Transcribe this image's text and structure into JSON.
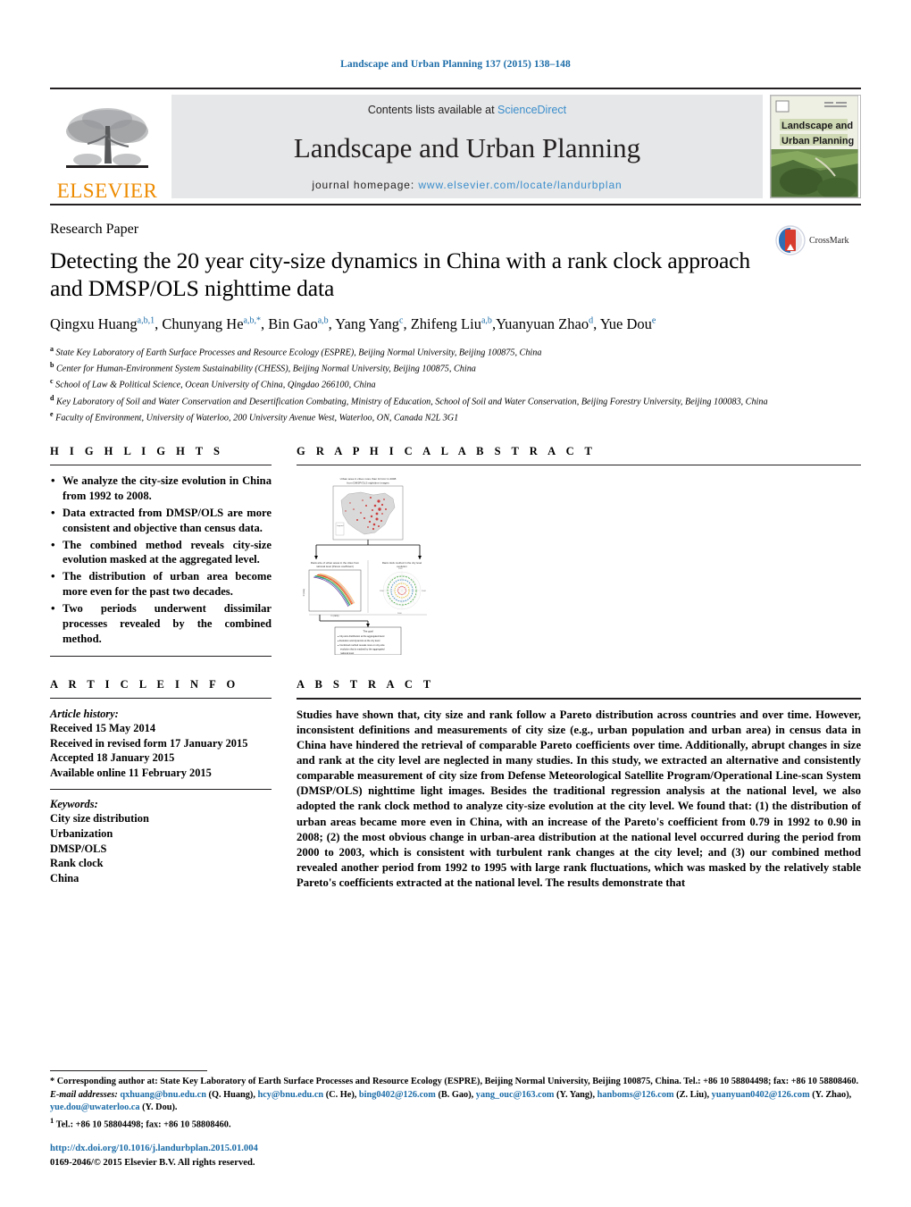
{
  "running_head": "Landscape and Urban Planning 137 (2015) 138–148",
  "masthead": {
    "publisher_logo_text": "ELSEVIER",
    "contents_prefix": "Contents lists available at ",
    "contents_link": "ScienceDirect",
    "journal_name": "Landscape and Urban Planning",
    "homepage_label": "journal homepage:",
    "homepage_url": "www.elsevier.com/locate/landurbplan",
    "cover": {
      "line1": "Landscape and",
      "line2": "Urban Planning"
    }
  },
  "article": {
    "doctype": "Research Paper",
    "title": "Detecting the 20 year city-size dynamics in China with a rank clock approach and DMSP/OLS nighttime data",
    "crossmark_label": "CrossMark",
    "authors": [
      {
        "name": "Qingxu Huang",
        "marks": "a,b,1",
        "sep": ", "
      },
      {
        "name": "Chunyang He",
        "marks": "a,b,*",
        "sep": ", "
      },
      {
        "name": "Bin Gao",
        "marks": "a,b",
        "sep": ", "
      },
      {
        "name": "Yang Yang",
        "marks": "c",
        "sep": ", "
      },
      {
        "name": "Zhifeng Liu",
        "marks": "a,b",
        "sep": ","
      },
      {
        "name": "Yuanyuan Zhao",
        "marks": "d",
        "sep": ", "
      },
      {
        "name": "Yue Dou",
        "marks": "e",
        "sep": ""
      }
    ],
    "affiliations": [
      {
        "mark": "a",
        "text": "State Key Laboratory of Earth Surface Processes and Resource Ecology (ESPRE), Beijing Normal University, Beijing 100875, China"
      },
      {
        "mark": "b",
        "text": "Center for Human-Environment System Sustainability (CHESS), Beijing Normal University, Beijing 100875, China"
      },
      {
        "mark": "c",
        "text": "School of Law & Political Science, Ocean University of China, Qingdao 266100, China"
      },
      {
        "mark": "d",
        "text": "Key Laboratory of Soil and Water Conservation and Desertification Combating, Ministry of Education, School of Soil and Water Conservation, Beijing Forestry University, Beijing 100083, China"
      },
      {
        "mark": "e",
        "text": "Faculty of Environment, University of Waterloo, 200 University Avenue West, Waterloo, ON, Canada N2L 3G1"
      }
    ]
  },
  "highlights": {
    "heading": "H I G H L I G H T S",
    "items": [
      "We analyze the city-size evolution in China from 1992 to 2008.",
      "Data extracted from DMSP/OLS are more consistent and objective than census data.",
      "The combined method reveals city-size evolution masked at the aggregated level.",
      "The distribution of urban area become more even for the past two decades.",
      "Two periods underwent dissimilar processes revealed by the combined method."
    ]
  },
  "graphical_abstract": {
    "heading": "G R A P H I C A L   A B S T R A C T",
    "figure": {
      "panel_top_caption": "Urban area in cities more than 10 km² in 2008 from DMSP/OLS nighttime images",
      "panel_left_caption": "Rank-size of urban areas in the cities from national level (Pareto coefficient)",
      "panel_right_caption": "Rank clock method in the city level evolution",
      "panel_bottom_caption": "The goal",
      "panel_bottom_items": [
        "City-size distribution at the aggregated level",
        "Evolution and dynamics at the city level",
        "Combined method reveals more on city-size evolution that is masked by the aggregated national level"
      ]
    }
  },
  "article_info": {
    "heading": "A R T I C L E   I N F O",
    "history_label": "Article history:",
    "history": [
      "Received 15 May 2014",
      "Received in revised form 17 January 2015",
      "Accepted 18 January 2015",
      "Available online 11 February 2015"
    ],
    "keywords_label": "Keywords:",
    "keywords": [
      "City size distribution",
      "Urbanization",
      "DMSP/OLS",
      "Rank clock",
      "China"
    ]
  },
  "abstract": {
    "heading": "A B S T R A C T",
    "text": "Studies have shown that, city size and rank follow a Pareto distribution across countries and over time. However, inconsistent definitions and measurements of city size (e.g., urban population and urban area) in census data in China have hindered the retrieval of comparable Pareto coefficients over time. Additionally, abrupt changes in size and rank at the city level are neglected in many studies. In this study, we extracted an alternative and consistently comparable measurement of city size from Defense Meteorological Satellite Program/Operational Line-scan System (DMSP/OLS) nighttime light images. Besides the traditional regression analysis at the national level, we also adopted the rank clock method to analyze city-size evolution at the city level. We found that: (1) the distribution of urban areas became more even in China, with an increase of the Pareto's coefficient from 0.79 in 1992 to 0.90 in 2008; (2) the most obvious change in urban-area distribution at the national level occurred during the period from 2000 to 2003, which is consistent with turbulent rank changes at the city level; and (3) our combined method revealed another period from 1992 to 1995 with large rank fluctuations, which was masked by the relatively stable Pareto's coefficients extracted at the national level. The results demonstrate that"
  },
  "footnotes": {
    "corresponding_marker": "*",
    "corresponding_text": "Corresponding author at: State Key Laboratory of Earth Surface Processes and Resource Ecology (ESPRE), Beijing Normal University, Beijing 100875, China. Tel.: +86 10 58804498; fax: +86 10 58808460.",
    "email_label": "E-mail addresses:",
    "emails": [
      {
        "address": "qxhuang@bnu.edu.cn",
        "person": "(Q. Huang),"
      },
      {
        "address": "hcy@bnu.edu.cn",
        "person": "(C. He),"
      },
      {
        "address": "bing0402@126.com",
        "person": "(B. Gao),"
      },
      {
        "address": "yang_ouc@163.com",
        "person": "(Y. Yang),"
      },
      {
        "address": "hanboms@126.com",
        "person": "(Z. Liu),"
      },
      {
        "address": "yuanyuan0402@126.com",
        "person": "(Y. Zhao),"
      },
      {
        "address": "yue.dou@uwaterloo.ca",
        "person": "(Y. Dou)."
      }
    ],
    "footnote_one_marker": "1",
    "footnote_one_text": "Tel.: +86 10 58804498; fax: +86 10 58808460."
  },
  "doi_block": {
    "doi_url": "http://dx.doi.org/10.1016/j.landurbplan.2015.01.004",
    "copyright": "0169-2046/© 2015 Elsevier B.V. All rights reserved."
  },
  "colors": {
    "link_blue": "#1b6ca8",
    "sciencedirect_blue": "#3a8dcc",
    "elsevier_orange": "#ed8b00",
    "band_gray": "#e6e7e8",
    "rule_black": "#231f20"
  }
}
